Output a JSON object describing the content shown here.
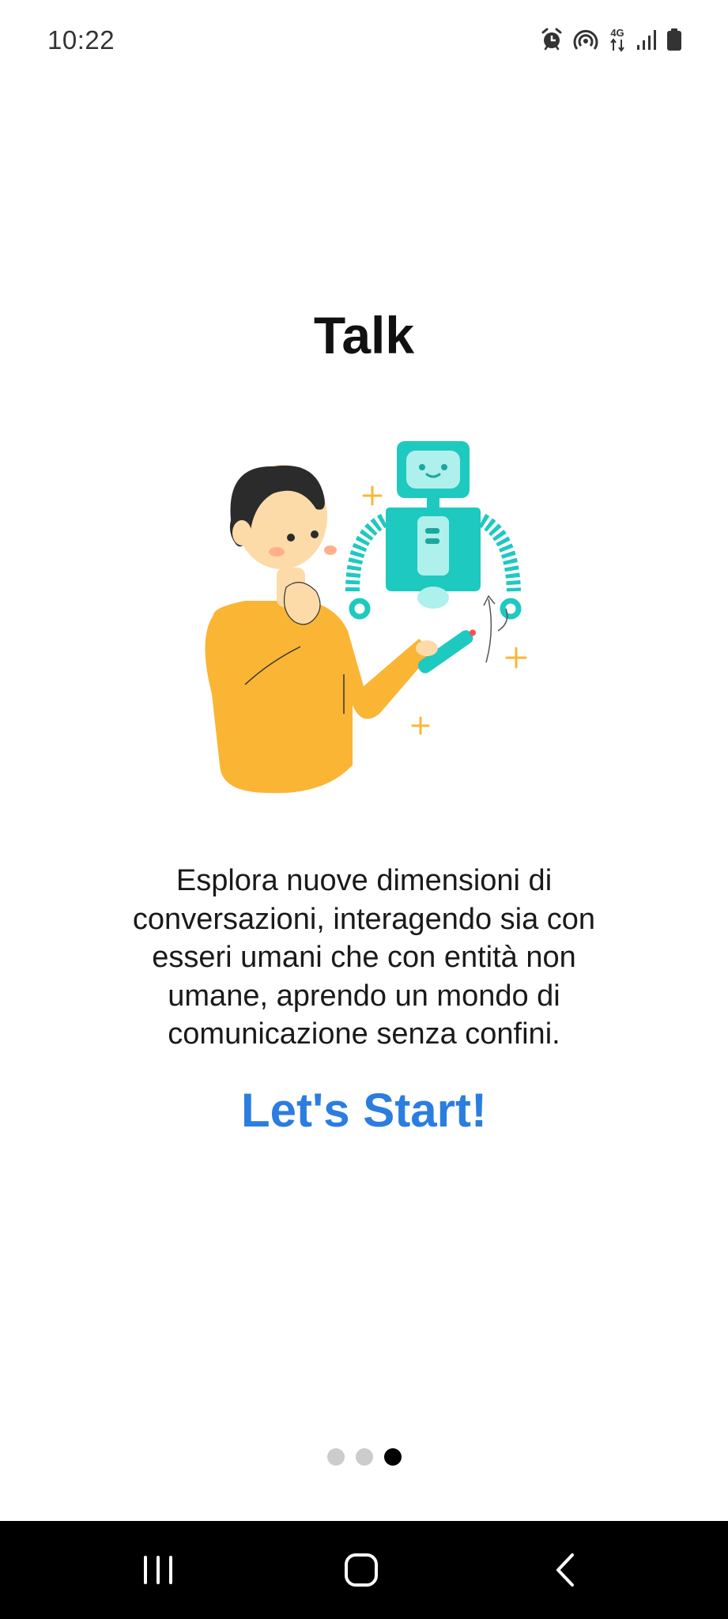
{
  "status_bar": {
    "time": "10:22",
    "icons": [
      "alarm-icon",
      "hotspot-icon",
      "network-4g-icon",
      "signal-icon",
      "battery-icon"
    ],
    "network_label": "4G"
  },
  "onboarding": {
    "title": "Talk",
    "illustration": "person-and-robot-illustration",
    "description": "Esplora nuove dimensioni di conversazioni, interagendo sia con esseri umani che con entità non umane, aprendo un mondo di comunicazione senza confini.",
    "start_label": "Let's Start!",
    "pages_total": 3,
    "current_page": 3
  },
  "colors": {
    "accent": "#2b7de0",
    "robot": "#1ec9c0",
    "shirt": "#fbb535",
    "dot_inactive": "#cccccc",
    "dot_active": "#000000"
  },
  "nav_bar": {
    "buttons": [
      "recent-apps-icon",
      "home-icon",
      "back-icon"
    ]
  }
}
